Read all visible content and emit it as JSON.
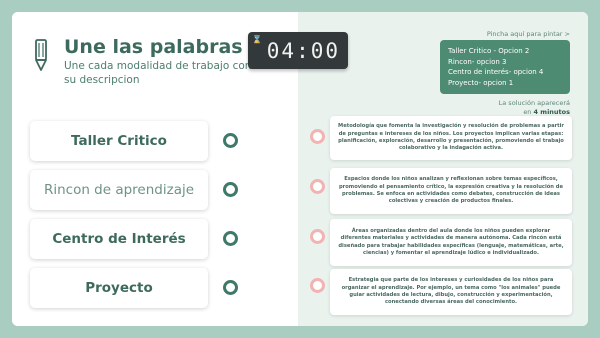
{
  "header": {
    "title": "Une las palabras",
    "subtitle": "Une cada modalidad de trabajo con su descripcion"
  },
  "timer": {
    "icon": "hourglass-icon",
    "value": "04:00"
  },
  "words": [
    {
      "label": "Taller Critico"
    },
    {
      "label": "Rincon de aprendizaje"
    },
    {
      "label": "Centro de Interés"
    },
    {
      "label": "Proyecto"
    }
  ],
  "paint_hint": "Pincha aquí para pintar >",
  "solution": {
    "lines": [
      "Taller Critico - Opcion 2",
      "Rincon- opcion 3",
      "Centro de interés- opcion 4",
      "Proyecto- opcion 1"
    ],
    "note_prefix": "La solución aparecerá",
    "note_in": "en",
    "note_time": "4 minutos"
  },
  "descriptions": [
    "Metodología que fomenta la investigación y resolución de problemas a partir de preguntas e intereses de los niños. Los proyectos implican varias etapas: planificación, exploración, desarrollo y presentación, promoviendo el trabajo colaborativo y la indagación activa.",
    "Espacios donde los niños analizan y reflexionan sobre temas específicos, promoviendo el pensamiento crítico, la expresión creativa y la resolución de problemas. Se enfoca en actividades como debates, construcción de ideas colectivas y creación de productos finales.",
    "Áreas organizadas dentro del aula donde los niños pueden explorar diferentes materiales y actividades de manera autónoma. Cada rincón está diseñado para trabajar habilidades específicas (lenguaje, matemáticas, arte, ciencias) y fomentar el aprendizaje lúdico e individualizado.",
    "Estrategia que parte de los intereses y curiosidades de los niños para organizar el aprendizaje. Por ejemplo, un tema como \"los animales\" puede guiar actividades de lectura, dibujo, construcción y experimentación, conectando diversas áreas del conocimiento."
  ],
  "colors": {
    "background": "#a9cdc1",
    "accent": "#3e6a5e",
    "solution_box": "#4e8b73",
    "left_dot": "#3f7a69",
    "right_dot": "#f2b4b2",
    "right_panel": "#eaf2ee"
  }
}
